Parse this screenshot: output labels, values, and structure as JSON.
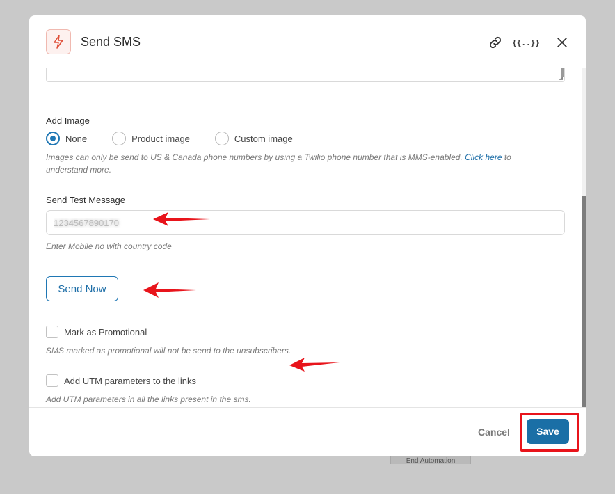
{
  "background": {
    "node_label": "End Automation"
  },
  "modal": {
    "title": "Send SMS",
    "header_icons": [
      "bolt-icon",
      "link-icon",
      "merge-tags-icon",
      "close-icon"
    ],
    "merge_tags_glyph": "{{..}}"
  },
  "add_image": {
    "label": "Add Image",
    "options": [
      {
        "label": "None",
        "checked": true
      },
      {
        "label": "Product image",
        "checked": false
      },
      {
        "label": "Custom image",
        "checked": false
      }
    ],
    "help_text": "Images can only be send to US & Canada phone numbers by using a Twilio phone number that is MMS-enabled.",
    "help_link": "Click here",
    "help_suffix": "to understand more."
  },
  "test_message": {
    "label": "Send Test Message",
    "value": "1234567890170",
    "help_text": "Enter Mobile no with country code",
    "send_button": "Send Now"
  },
  "promotional": {
    "label": "Mark as Promotional",
    "checked": false,
    "help_text": "SMS marked as promotional will not be send to the unsubscribers."
  },
  "utm": {
    "label": "Add UTM parameters to the links",
    "checked": false,
    "help_text": "Add UTM parameters in all the links present in the sms."
  },
  "footer": {
    "cancel_label": "Cancel",
    "save_label": "Save"
  },
  "colors": {
    "accent": "#1f77b4",
    "save_bg": "#1a6fa6",
    "highlight": "#e8141b",
    "annotation_arrow": "#e8141b"
  }
}
